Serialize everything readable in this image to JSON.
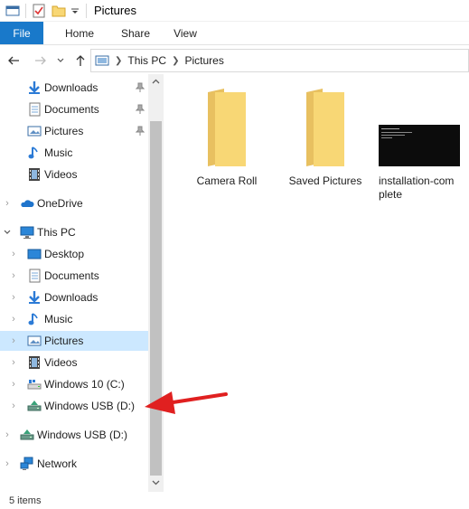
{
  "window": {
    "title": "Pictures"
  },
  "ribbon": {
    "tabs": [
      {
        "label": "File"
      },
      {
        "label": "Home"
      },
      {
        "label": "Share"
      },
      {
        "label": "View"
      }
    ]
  },
  "address": {
    "crumbs": [
      "This PC",
      "Pictures"
    ]
  },
  "nav": {
    "quick_access": [
      {
        "label": "Downloads",
        "icon": "download-arrow-icon",
        "pinned": true
      },
      {
        "label": "Documents",
        "icon": "documents-icon",
        "pinned": true
      },
      {
        "label": "Pictures",
        "icon": "pictures-icon",
        "pinned": true
      },
      {
        "label": "Music",
        "icon": "music-note-icon",
        "pinned": false
      },
      {
        "label": "Videos",
        "icon": "film-icon",
        "pinned": false
      }
    ],
    "onedrive": {
      "label": "OneDrive",
      "icon": "cloud-icon"
    },
    "this_pc": {
      "label": "This PC",
      "icon": "computer-icon",
      "children": [
        {
          "label": "Desktop",
          "icon": "desktop-icon"
        },
        {
          "label": "Documents",
          "icon": "documents-icon"
        },
        {
          "label": "Downloads",
          "icon": "download-arrow-icon"
        },
        {
          "label": "Music",
          "icon": "music-note-icon"
        },
        {
          "label": "Pictures",
          "icon": "pictures-icon",
          "selected": true
        },
        {
          "label": "Videos",
          "icon": "film-icon"
        },
        {
          "label": "Windows 10 (C:)",
          "icon": "drive-icon"
        },
        {
          "label": "Windows USB (D:)",
          "icon": "usb-drive-icon"
        }
      ]
    },
    "usb_root": {
      "label": "Windows USB (D:)",
      "icon": "usb-drive-icon"
    },
    "network": {
      "label": "Network",
      "icon": "network-icon"
    }
  },
  "files": [
    {
      "label": "Camera Roll",
      "type": "folder"
    },
    {
      "label": "Saved Pictures",
      "type": "folder"
    },
    {
      "label": "installation-com plete",
      "type": "image"
    }
  ],
  "status": {
    "items": "5 items"
  },
  "colors": {
    "accent": "#1979ca",
    "selection": "#cce8ff",
    "folder": "#f8d775",
    "annotation_arrow": "#e02020"
  }
}
